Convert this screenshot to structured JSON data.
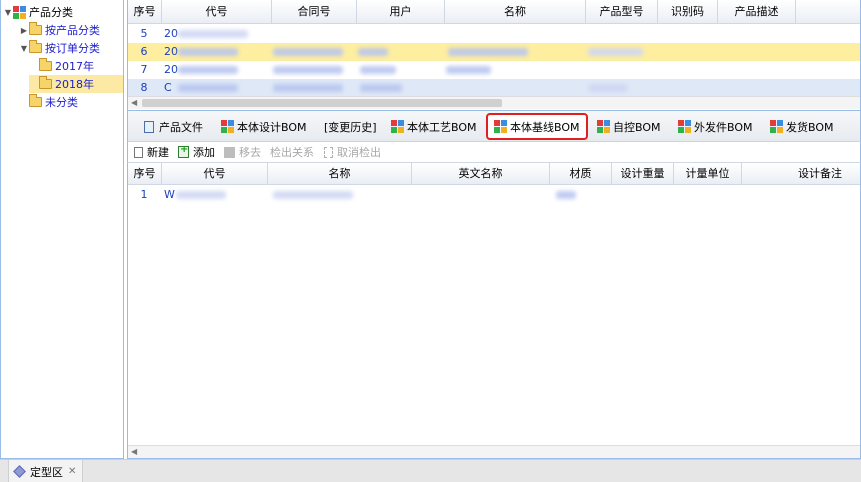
{
  "tree": {
    "items": [
      {
        "label": "产品分类",
        "expanded": true,
        "icon": "category-icon"
      },
      {
        "label": "按产品分类",
        "expanded": false,
        "icon": "folder-icon"
      },
      {
        "label": "按订单分类",
        "expanded": true,
        "icon": "folder-icon"
      },
      {
        "label": "2017年",
        "icon": "folder-icon"
      },
      {
        "label": "2018年",
        "icon": "folder-icon",
        "selected": true
      },
      {
        "label": "未分类",
        "icon": "folder-icon"
      }
    ]
  },
  "top_grid": {
    "columns": [
      "序号",
      "代号",
      "合同号",
      "用户",
      "名称",
      "产品型号",
      "识别码",
      "产品描述"
    ],
    "rows": [
      {
        "no": "5",
        "code_prefix": "20"
      },
      {
        "no": "6",
        "code_prefix": "20",
        "highlighted": true
      },
      {
        "no": "7",
        "code_prefix": "20"
      },
      {
        "no": "8",
        "code_prefix": "C"
      }
    ]
  },
  "tabs": [
    {
      "label": "产品文件",
      "icon": "document-icon"
    },
    {
      "label": "本体设计BOM",
      "icon": "bom-icon"
    },
    {
      "label": "[变更历史]",
      "icon": ""
    },
    {
      "label": "本体工艺BOM",
      "icon": "bom-icon"
    },
    {
      "label": "本体基线BOM",
      "icon": "bom-icon",
      "active": true
    },
    {
      "label": "自控BOM",
      "icon": "bom-icon"
    },
    {
      "label": "外发件BOM",
      "icon": "bom-icon"
    },
    {
      "label": "发货BOM",
      "icon": "bom-icon"
    }
  ],
  "toolbar": {
    "new_label": "新建",
    "add_label": "添加",
    "move_label": "移去",
    "checkout_label": "检出关系",
    "cancel_checkout_label": "取消检出"
  },
  "bottom_grid": {
    "columns": [
      "序号",
      "代号",
      "名称",
      "英文名称",
      "材质",
      "设计重量",
      "计量单位",
      "设计备注"
    ],
    "rows": [
      {
        "no": "1",
        "code_prefix": "W"
      }
    ]
  },
  "status_bar": {
    "tab_label": "定型区",
    "close_glyph": "✕"
  },
  "colors": {
    "accent_border": "#99bbe8",
    "selection": "#fbe9a4",
    "active_tab_outline": "#e02020",
    "link_text": "#1d1dcc"
  }
}
